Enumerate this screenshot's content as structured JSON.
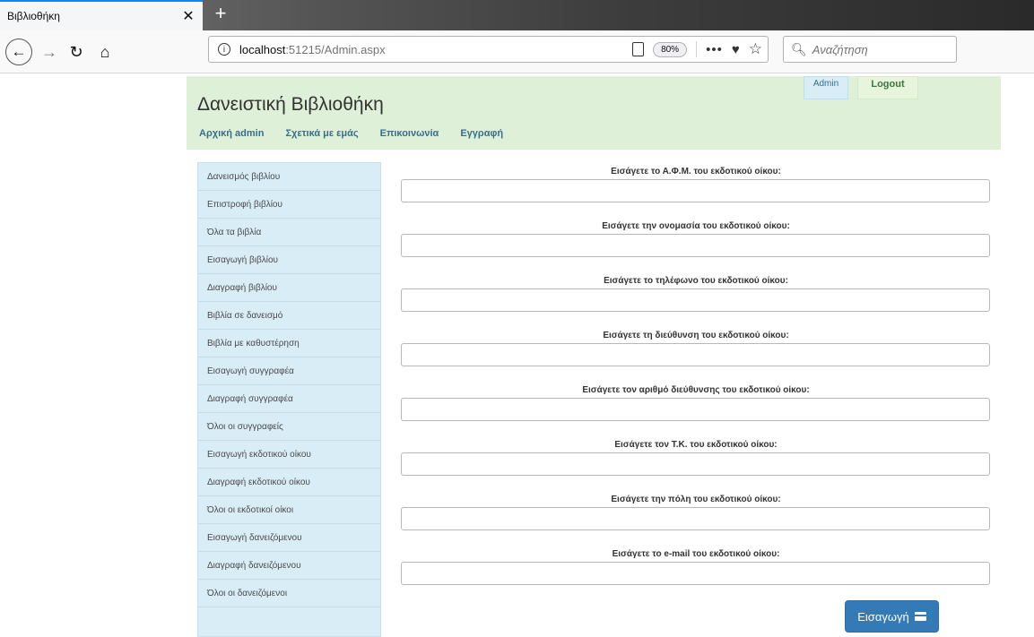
{
  "browser": {
    "tab_title": "Βιβλιοθήκη",
    "tab_close": "✕",
    "new_tab": "+",
    "url_host": "localhost",
    "url_path": ":51215/Admin.aspx",
    "zoom": "80%",
    "search_placeholder": "Αναζήτηση",
    "icons": [
      "back-arrow-icon",
      "forward-arrow-icon",
      "reload-icon",
      "home-icon",
      "info-icon",
      "reader-view-icon",
      "more-icon",
      "pocket-icon",
      "bookmark-star-icon",
      "search-icon"
    ]
  },
  "header": {
    "title": "Δανειστική Βιβλιοθήκη",
    "nav": [
      "Αρχική admin",
      "Σχετικά με εμάς",
      "Επικοινωνία",
      "Εγγραφή"
    ],
    "admin_label": "Admin",
    "logout_label": "Logout",
    "colors": {
      "jumbotron": "#dff0d8",
      "nav_link": "#3a6d8c"
    }
  },
  "sidebar": {
    "items": [
      "Δανεισμός βιβλίου",
      "Επιστροφή βιβλίου",
      "Όλα τα βιβλία",
      "Εισαγωγή βιβλίου",
      "Διαγραφή βιβλίου",
      "Βιβλία σε δανεισμό",
      "Βιβλία με καθυστέρηση",
      "Εισαγωγή συγγραφέα",
      "Διαγραφή συγγραφέα",
      "Όλοι οι συγγραφείς",
      "Εισαγωγή εκδοτικού οίκου",
      "Διαγραφή εκδοτικού οίκου",
      "Όλοι οι εκδοτικοί οίκοι",
      "Εισαγωγή δανειζόμενου",
      "Διαγραφή δανειζόμενου",
      "Όλοι οι δανειζόμενοι"
    ],
    "color": "#d9edf7"
  },
  "form": {
    "fields": [
      {
        "label": "Εισάγετε το Α.Φ.Μ. του εκδοτικού οίκου:",
        "value": ""
      },
      {
        "label": "Εισάγετε την ονομασία του εκδοτικού οίκου:",
        "value": ""
      },
      {
        "label": "Εισάγετε το τηλέφωνο του εκδοτικού οίκου:",
        "value": ""
      },
      {
        "label": "Εισάγετε τη διεύθυνση του εκδοτικού οίκου:",
        "value": ""
      },
      {
        "label": "Εισάγετε τον αριθμό διεύθυνσης του εκδοτικού οίκου:",
        "value": ""
      },
      {
        "label": "Εισάγετε τον Τ.Κ. του εκδοτικού οίκου:",
        "value": ""
      },
      {
        "label": "Εισάγετε την πόλη του εκδοτικού οίκου:",
        "value": ""
      },
      {
        "label": "Εισάγετε το e-mail του εκδοτικού οίκου:",
        "value": ""
      }
    ],
    "submit_label": "Εισαγωγή",
    "submit_icon": "credit-card-icon",
    "submit_color": "#337ab7"
  }
}
